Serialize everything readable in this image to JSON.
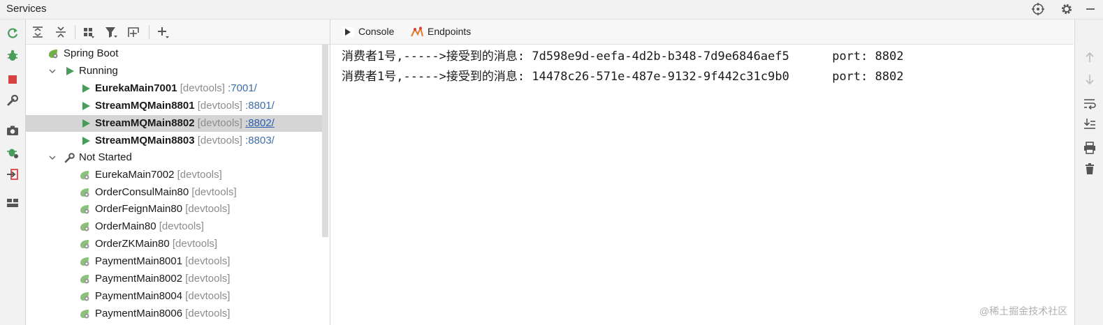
{
  "window": {
    "title": "Services"
  },
  "tabs": [
    {
      "label": "Console",
      "icon": "console-icon",
      "active": true
    },
    {
      "label": "Endpoints",
      "icon": "endpoints-icon",
      "active": false
    }
  ],
  "tree": {
    "root": {
      "label": "Spring Boot",
      "icon": "spring-boot-icon"
    },
    "running_group": {
      "label": "Running"
    },
    "running": [
      {
        "name": "EurekaMain7001",
        "tag": "[devtools]",
        "port": ":7001/"
      },
      {
        "name": "StreamMQMain8801",
        "tag": "[devtools]",
        "port": ":8801/"
      },
      {
        "name": "StreamMQMain8802",
        "tag": "[devtools]",
        "port": ":8802/"
      },
      {
        "name": "StreamMQMain8803",
        "tag": "[devtools]",
        "port": ":8803/"
      }
    ],
    "not_started_group": {
      "label": "Not Started"
    },
    "not_started": [
      {
        "name": "EurekaMain7002",
        "tag": "[devtools]"
      },
      {
        "name": "OrderConsulMain80",
        "tag": "[devtools]"
      },
      {
        "name": "OrderFeignMain80",
        "tag": "[devtools]"
      },
      {
        "name": "OrderMain80",
        "tag": "[devtools]"
      },
      {
        "name": "OrderZKMain80",
        "tag": "[devtools]"
      },
      {
        "name": "PaymentMain8001",
        "tag": "[devtools]"
      },
      {
        "name": "PaymentMain8002",
        "tag": "[devtools]"
      },
      {
        "name": "PaymentMain8004",
        "tag": "[devtools]"
      },
      {
        "name": "PaymentMain8006",
        "tag": "[devtools]"
      }
    ]
  },
  "console": {
    "lines": [
      "消费者1号,----->接受到的消息: 7d598e9d-eefa-4d2b-b348-7d9e6846aef5      port: 8802",
      "消费者1号,----->接受到的消息: 14478c26-571e-487e-9132-9f442c31c9b0      port: 8802"
    ]
  },
  "watermark": "@稀土掘金技术社区",
  "colors": {
    "run_green": "#4a9c5a",
    "stop_red": "#d64242",
    "link_blue": "#2a5db0",
    "selection": "#d5d5d5"
  }
}
